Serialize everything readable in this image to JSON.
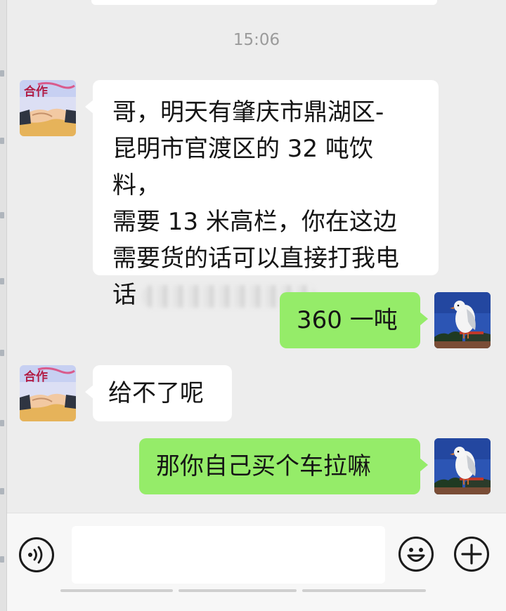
{
  "chat": {
    "timestamp": "15:06",
    "messages": [
      {
        "sender": "contact",
        "lines": [
          "哥，明天有肇庆市鼎湖区-",
          "昆明市官渡区的 32 吨饮料，",
          "需要 13 米高栏，你在这边",
          "需要货的话可以直接打我电",
          "话"
        ]
      },
      {
        "sender": "me",
        "text": "360 一吨"
      },
      {
        "sender": "contact",
        "text": "给不了呢"
      },
      {
        "sender": "me",
        "text": "那你自己买个车拉嘛"
      }
    ]
  },
  "contact_avatar": {
    "text": "合作"
  },
  "colors": {
    "background": "#ededed",
    "incoming_bubble": "#ffffff",
    "outgoing_bubble": "#95ec69",
    "timestamp": "#9b9b9b",
    "bottom_bar": "#f7f7f7"
  },
  "icons": {
    "voice": "voice-icon",
    "emoji": "emoji-icon",
    "plus": "plus-icon"
  }
}
